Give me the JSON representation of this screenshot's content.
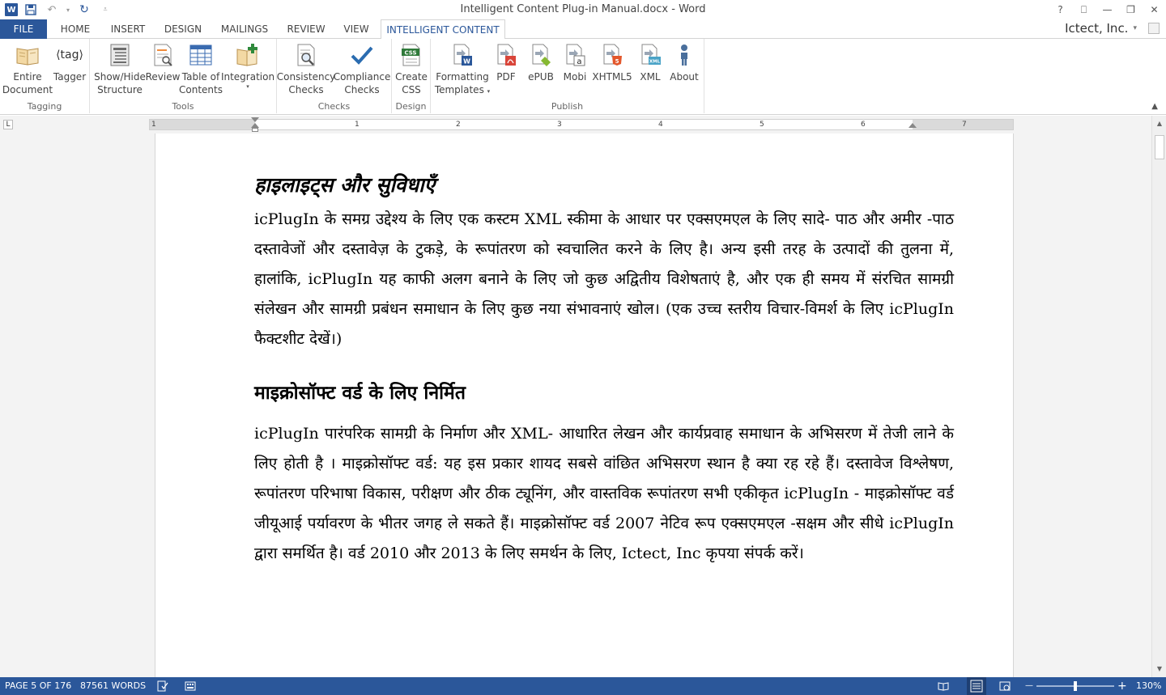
{
  "window": {
    "title": "Intelligent Content Plug-in Manual.docx - Word",
    "help": "?",
    "controls": [
      "⎕",
      "—",
      "❐",
      "✕"
    ]
  },
  "qat": {
    "logo": "W"
  },
  "tabs": [
    "FILE",
    "HOME",
    "INSERT",
    "DESIGN",
    "MAILINGS",
    "REVIEW",
    "VIEW",
    "INTELLIGENT CONTENT"
  ],
  "account": "Ictect, Inc.",
  "ribbon": {
    "groups": {
      "tagging": "Tagging",
      "tools": "Tools",
      "checks": "Checks",
      "design": "Design",
      "publish": "Publish"
    },
    "buttons": {
      "entire_document": [
        "Entire",
        "Document"
      ],
      "tagger": "Tagger",
      "tagger_icon_text": "⟨tag⟩",
      "show_hide": [
        "Show/Hide",
        "Structure"
      ],
      "review": "Review",
      "toc": [
        "Table of",
        "Contents"
      ],
      "integration": "Integration",
      "consistency": [
        "Consistency",
        "Checks"
      ],
      "compliance": [
        "Compliance",
        "Checks"
      ],
      "create_css": [
        "Create",
        "CSS"
      ],
      "css_icon_text": "CSS",
      "formatting": [
        "Formatting",
        "Templates"
      ],
      "pdf": "PDF",
      "epub": "ePUB",
      "mobi": "Mobi",
      "xhtml5": "XHTML5",
      "xml": "XML",
      "about": "About"
    }
  },
  "ruler": {
    "numbers": [
      "1",
      "1",
      "2",
      "3",
      "4",
      "5",
      "6",
      "7"
    ],
    "tab_selector": "L"
  },
  "document": {
    "heading1": "हाइलाइट्स और सुविधाएँ",
    "para1": "icPlugIn के समग्र उद्देश्य के लिए एक कस्टम XML स्कीमा के आधार पर एक्सएमएल के लिए सादे- पाठ और अमीर -पाठ दस्तावेजों और दस्तावेज़ के टुकड़े, के रूपांतरण को स्वचालित करने के लिए है। अन्य इसी तरह के उत्पादों की तुलना में, हालांकि, icPlugIn यह काफी अलग बनाने के लिए जो कुछ अद्वितीय विशेषताएं है, और एक ही समय में संरचित सामग्री संलेखन और सामग्री प्रबंधन समाधान के लिए कुछ नया संभावनाएं खोल। (एक उच्च स्तरीय विचार-विमर्श के लिए icPlugIn फैक्टशीट देखें।)",
    "heading2": "माइक्रोसॉफ्ट वर्ड के लिए निर्मित",
    "para2": "icPlugIn पारंपरिक सामग्री के निर्माण और XML- आधारित लेखन और कार्यप्रवाह समाधान के अभिसरण में तेजी लाने के लिए होती है । माइक्रोसॉफ्ट वर्ड: यह इस प्रकार शायद सबसे वांछित अभिसरण स्थान है क्या रह रहे हैं। दस्तावेज विश्लेषण, रूपांतरण परिभाषा विकास, परीक्षण और ठीक ट्यूनिंग, और वास्तविक रूपांतरण सभी एकीकृत icPlugIn - माइक्रोसॉफ्ट वर्ड जीयूआई पर्यावरण के भीतर जगह ले सकते हैं। माइक्रोसॉफ्ट वर्ड 2007 नेटिव रूप एक्सएमएल -सक्षम और सीधे icPlugIn द्वारा समर्थित है। वर्ड 2010 और 2013 के लिए समर्थन के लिए, Ictect, Inc कृपया संपर्क करें।"
  },
  "status": {
    "page": "PAGE 5 OF 176",
    "words": "87561 WORDS",
    "zoom": "130%",
    "zoom_minus": "—",
    "zoom_plus": "+"
  },
  "colors": {
    "accent": "#2b579a"
  }
}
